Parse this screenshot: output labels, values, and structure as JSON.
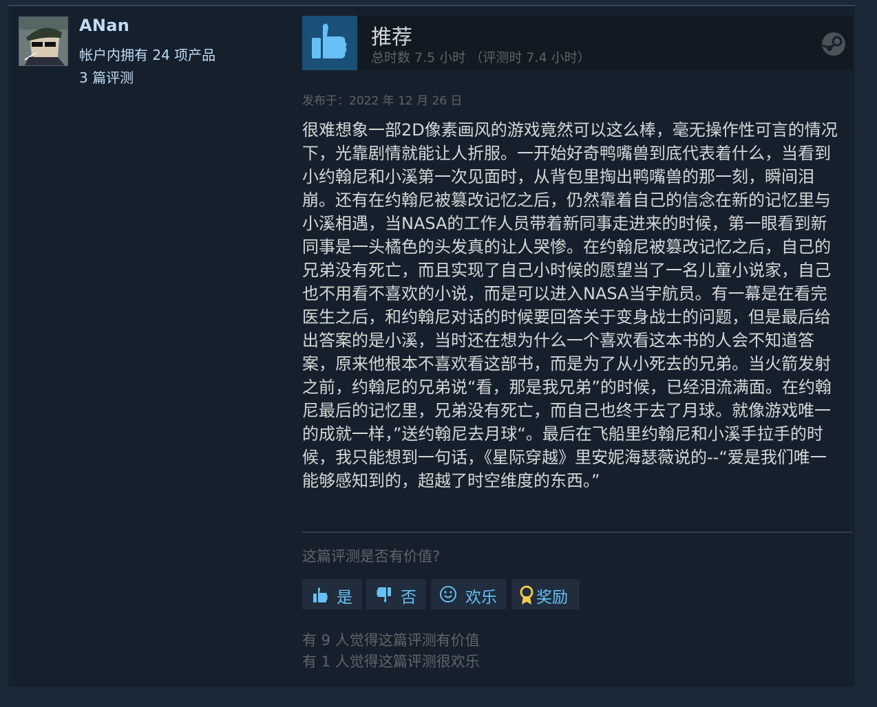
{
  "author": {
    "username": "ANan",
    "products": "帐户内拥有 24 项产品",
    "reviews": "3 篇评测"
  },
  "review": {
    "verdict": "推荐",
    "hours": "总时数 7.5 小时 （评测时 7.4 小时）",
    "posted": "发布于：2022 年 12 月 26 日",
    "body": "很难想象一部2D像素画风的游戏竟然可以这么棒，毫无操作性可言的情况下，光靠剧情就能让人折服。一开始好奇鸭嘴兽到底代表着什么，当看到小约翰尼和小溪第一次见面时，从背包里掏出鸭嘴兽的那一刻，瞬间泪崩。还有在约翰尼被篡改记忆之后，仍然靠着自己的信念在新的记忆里与小溪相遇，当NASA的工作人员带着新同事走进来的时候，第一眼看到新同事是一头橘色的头发真的让人哭惨。在约翰尼被篡改记忆之后，自己的兄弟没有死亡，而且实现了自己小时候的愿望当了一名儿童小说家，自己也不用看不喜欢的小说，而是可以进入NASA当宇航员。有一幕是在看完医生之后，和约翰尼对话的时候要回答关于变身战士的问题，但是最后给出答案的是小溪，当时还在想为什么一个喜欢看这本书的人会不知道答案，原来他根本不喜欢看这部书，而是为了从小死去的兄弟。当火箭发射之前，约翰尼的兄弟说“看，那是我兄弟”的时候，已经泪流满面。在约翰尼最后的记忆里，兄弟没有死亡，而自己也终于去了月球。就像游戏唯一的成就一样，”送约翰尼去月球“。最后在飞船里约翰尼和小溪手拉手的时候，我只能想到一句话，《星际穿越》里安妮海瑟薇说的--“爱是我们唯一能够感知到的，超越了时空维度的东西。”"
  },
  "feedback": {
    "question": "这篇评测是否有价值?",
    "buttons": {
      "yes": "是",
      "no": "否",
      "funny": "欢乐",
      "award": "奖励"
    },
    "stats": {
      "helpful": "有 9 人觉得这篇评测有价值",
      "funny": "有 1 人觉得这篇评测很欢乐"
    }
  },
  "icons": {
    "verdict": "thumbs-up-icon",
    "platform": "steam-logo-icon",
    "yes": "thumbs-up-icon",
    "no": "thumbs-down-icon",
    "funny": "smiley-icon",
    "award": "award-icon"
  },
  "colors": {
    "background": "#1b2838",
    "card": "#16202d",
    "accent": "#67c1f5",
    "verdict_block": "#1a4f77",
    "award": "#f2c94c"
  }
}
